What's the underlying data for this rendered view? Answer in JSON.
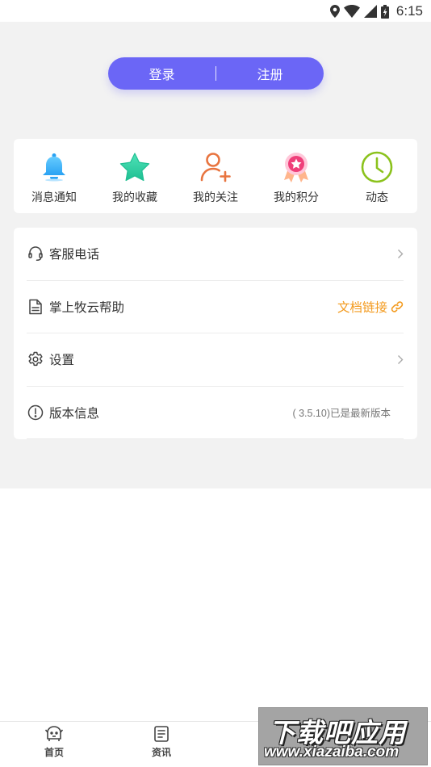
{
  "status_bar": {
    "time": "6:15"
  },
  "auth": {
    "login_label": "登录",
    "register_label": "注册"
  },
  "quick_actions": [
    {
      "label": "消息通知",
      "icon": "bell-icon"
    },
    {
      "label": "我的收藏",
      "icon": "star-icon"
    },
    {
      "label": "我的关注",
      "icon": "user-add-icon"
    },
    {
      "label": "我的积分",
      "icon": "medal-icon"
    },
    {
      "label": "动态",
      "icon": "clock-icon"
    }
  ],
  "menu": [
    {
      "label": "客服电话",
      "icon": "headset-icon"
    },
    {
      "label": "掌上牧云帮助",
      "icon": "document-icon",
      "link_text": "文档链接"
    },
    {
      "label": "设置",
      "icon": "gear-icon"
    },
    {
      "label": "版本信息",
      "icon": "info-icon",
      "value": "( 3.5.10)已是最新版本"
    }
  ],
  "tabbar": {
    "tabs": [
      {
        "label": "首页"
      },
      {
        "label": "资讯"
      }
    ]
  },
  "watermark": {
    "title": "下载吧应用",
    "url": "www.xiazaiba.com"
  },
  "colors": {
    "accent": "#6b66f6",
    "link": "#f39a1e",
    "background": "#f2f2f2"
  }
}
